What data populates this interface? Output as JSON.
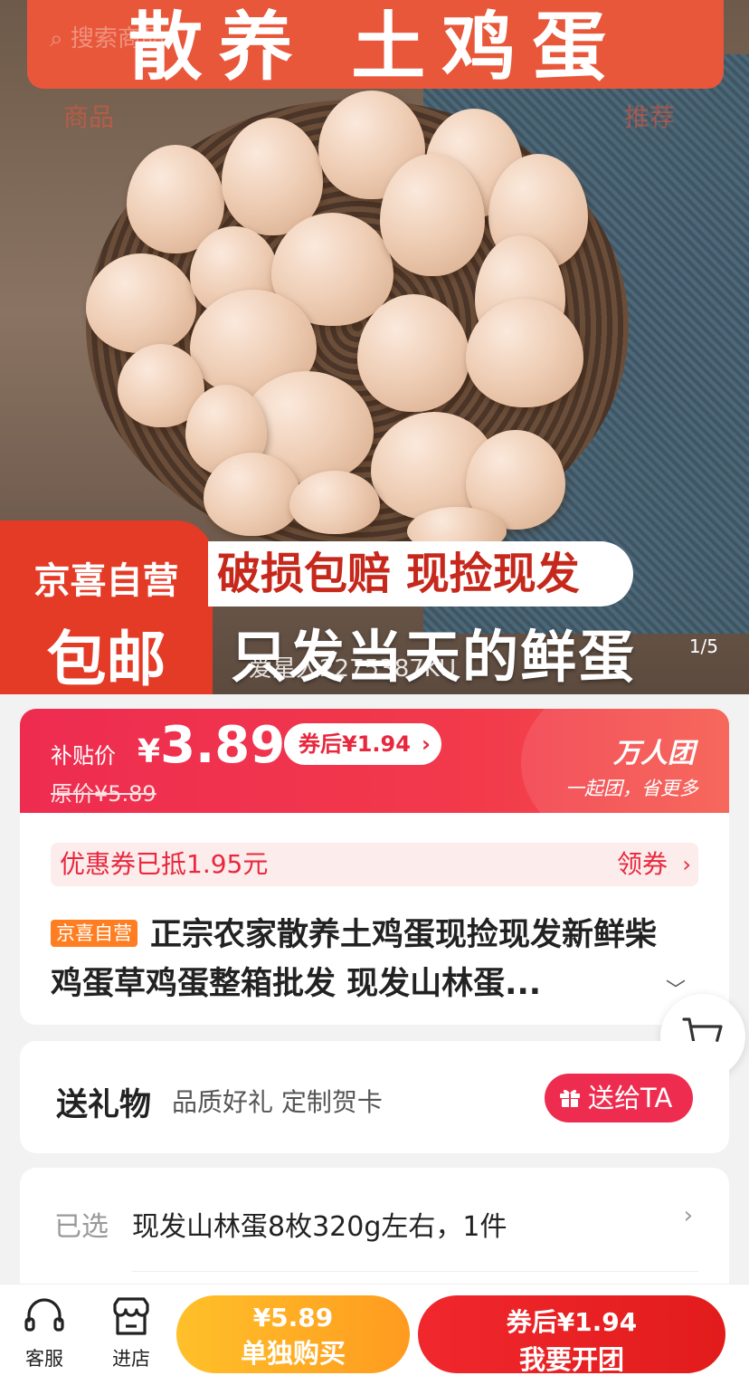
{
  "hero": {
    "banner_text": "散养 土鸡蛋",
    "ghost_search": "搜索商品",
    "ghost_tab_left": "商品",
    "ghost_tab_right": "推荐",
    "promo_store": "京喜自营",
    "promo_shipping": "包邮",
    "promo_guarantee": "破损包赔 现捡现发",
    "promo_fresh": "只发当天的鲜蛋",
    "watermark": "爱星人2275387KU",
    "image_counter": "1/5"
  },
  "price": {
    "label": "补贴价",
    "currency": "¥",
    "amount": "3.89",
    "coupon_pill": "券后¥1.94",
    "original": "原价¥5.89",
    "group_title": "万人团",
    "group_sub": "一起团，省更多"
  },
  "info": {
    "coupon_text": "优惠券已抵1.95元",
    "coupon_action": "领券",
    "badge": "京喜自营",
    "title": "正宗农家散养土鸡蛋现捡现发新鲜柴鸡蛋草鸡蛋整箱批发 现发山林蛋..."
  },
  "gift": {
    "title": "送礼物",
    "subtitle": "品质好礼 定制贺卡",
    "button": "送给TA"
  },
  "selection": {
    "label": "已选",
    "value": "现发山林蛋8枚320g左右，1件"
  },
  "bottom": {
    "service_label": "客服",
    "store_label": "进店",
    "solo_price": "¥5.89",
    "solo_label": "单独购买",
    "group_price": "券后¥1.94",
    "group_label": "我要开团"
  },
  "icons": [
    "search-icon",
    "headset-icon",
    "store-icon",
    "cart-icon",
    "gift-icon",
    "chevron-right-icon",
    "chevron-down-icon"
  ],
  "colors": {
    "accent": "#ee2c50",
    "orange": "#ff9b1f",
    "badge": "#ff7e21"
  }
}
